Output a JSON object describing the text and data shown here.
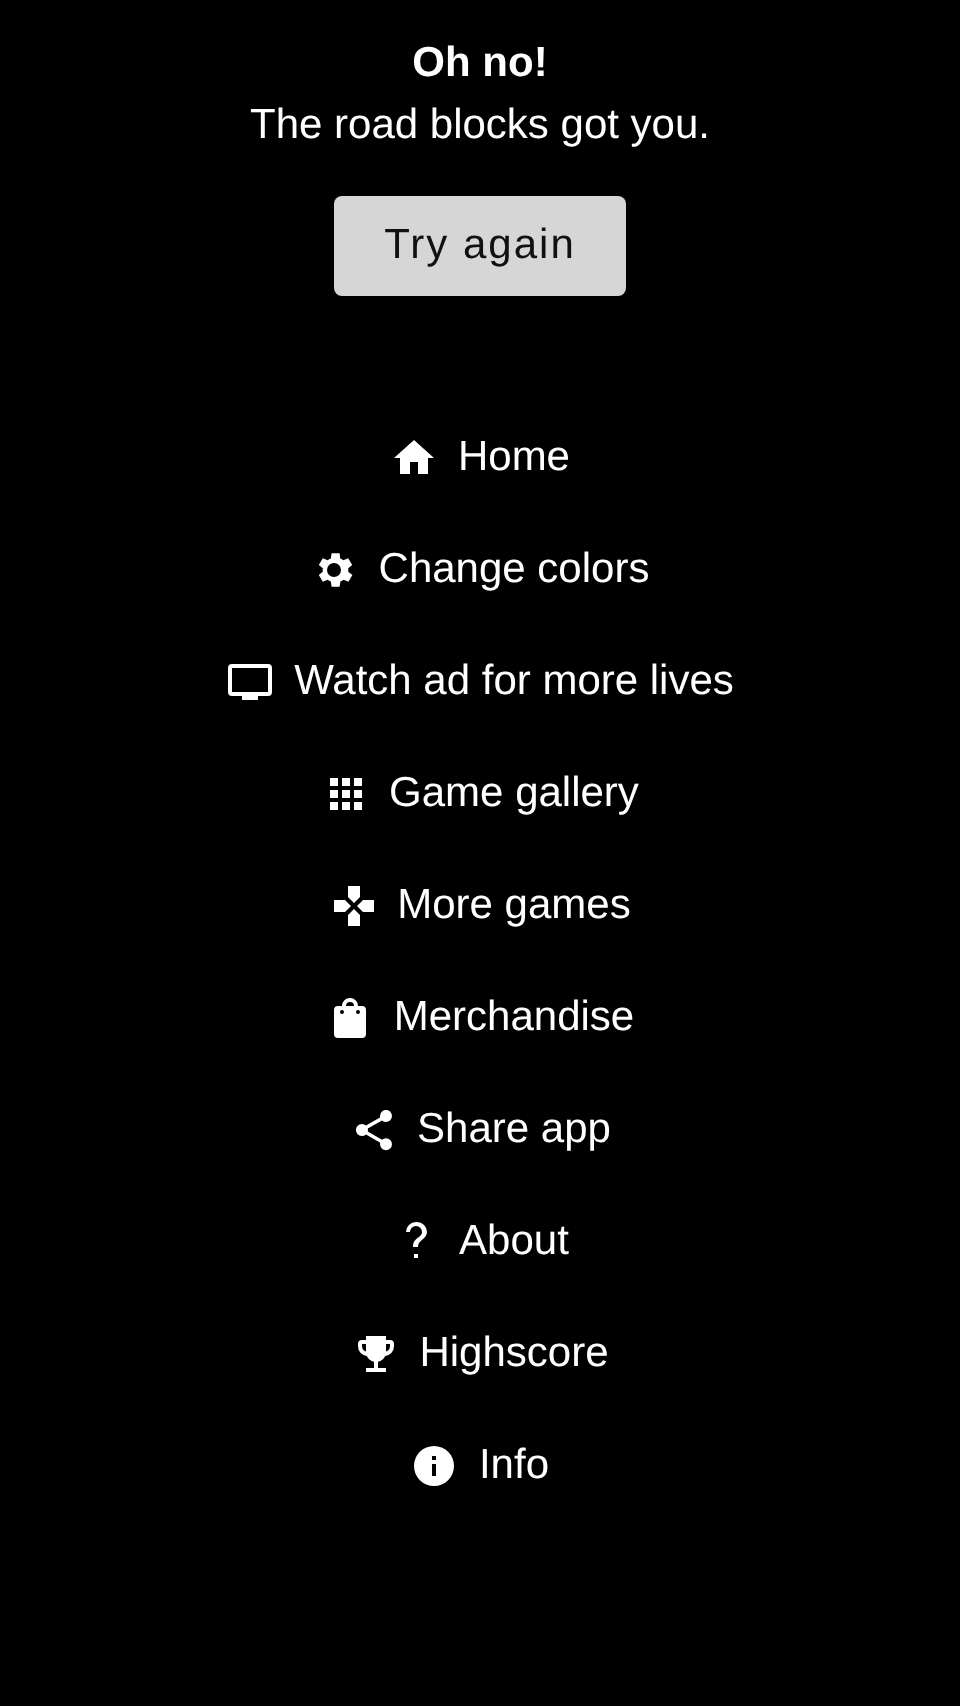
{
  "message": {
    "title": "Oh no!",
    "text": "The road blocks got you."
  },
  "retry_button": "Try again",
  "menu": [
    {
      "kind": "home",
      "label": "Home"
    },
    {
      "kind": "gear",
      "label": "Change colors"
    },
    {
      "kind": "tv",
      "label": "Watch ad for more lives"
    },
    {
      "kind": "grid",
      "label": "Game gallery"
    },
    {
      "kind": "gamepad",
      "label": "More games"
    },
    {
      "kind": "bag",
      "label": "Merchandise"
    },
    {
      "kind": "share",
      "label": "Share app"
    },
    {
      "kind": "help",
      "label": "About"
    },
    {
      "kind": "trophy",
      "label": "Highscore"
    },
    {
      "kind": "info",
      "label": "Info"
    }
  ]
}
